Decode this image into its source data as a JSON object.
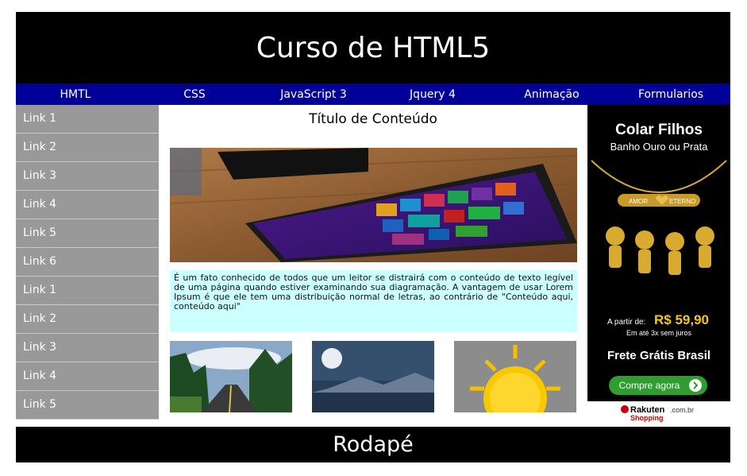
{
  "header": {
    "title": "Curso de HTML5"
  },
  "nav": {
    "items": [
      {
        "label": "HMTL"
      },
      {
        "label": "CSS"
      },
      {
        "label": "JavaScript 3"
      },
      {
        "label": "Jquery 4"
      },
      {
        "label": "Animação"
      },
      {
        "label": "Formularios"
      }
    ]
  },
  "sidebar": {
    "links": [
      {
        "label": "Link 1"
      },
      {
        "label": "Link 2"
      },
      {
        "label": "Link 3"
      },
      {
        "label": "Link 4"
      },
      {
        "label": "Link 5"
      },
      {
        "label": "Link 6"
      },
      {
        "label": "Link 1"
      },
      {
        "label": "Link 2"
      },
      {
        "label": "Link 3"
      },
      {
        "label": "Link 4"
      },
      {
        "label": "Link 5"
      }
    ]
  },
  "content": {
    "title": "Título de Conteúdo",
    "paragraph": "É um fato conhecido de todos que um leitor se distrairá com o conteúdo de texto legível de uma página quando estiver examinando sua diagramação. A vantagem de usar Lorem Ipsum é que ele tem uma distribuição normal de letras, ao contrário de \"Conteúdo aqui, conteúdo aqui\""
  },
  "ad": {
    "title": "Colar Filhos",
    "subtitle": "Banho Ouro ou Prata",
    "pendant_left": "AMOR",
    "pendant_right": "ETERNO",
    "price_prefix": "A partir de:",
    "price": "R$ 59,90",
    "installments": "Em até 3x sem juros",
    "shipping": "Frete Grátis Brasil",
    "cta": "Compre agora",
    "brand": "Rakuten",
    "brand_domain": ".com.br",
    "brand_sub": "Shopping"
  },
  "footer": {
    "text": "Rodapé"
  },
  "colors": {
    "header_bg": "#000000",
    "nav_bg": "#000099",
    "sidebar_bg": "#999999",
    "text_box_bg": "#ccffff",
    "ad_price": "#f5c518",
    "cta_bg": "#2e9e2e"
  }
}
